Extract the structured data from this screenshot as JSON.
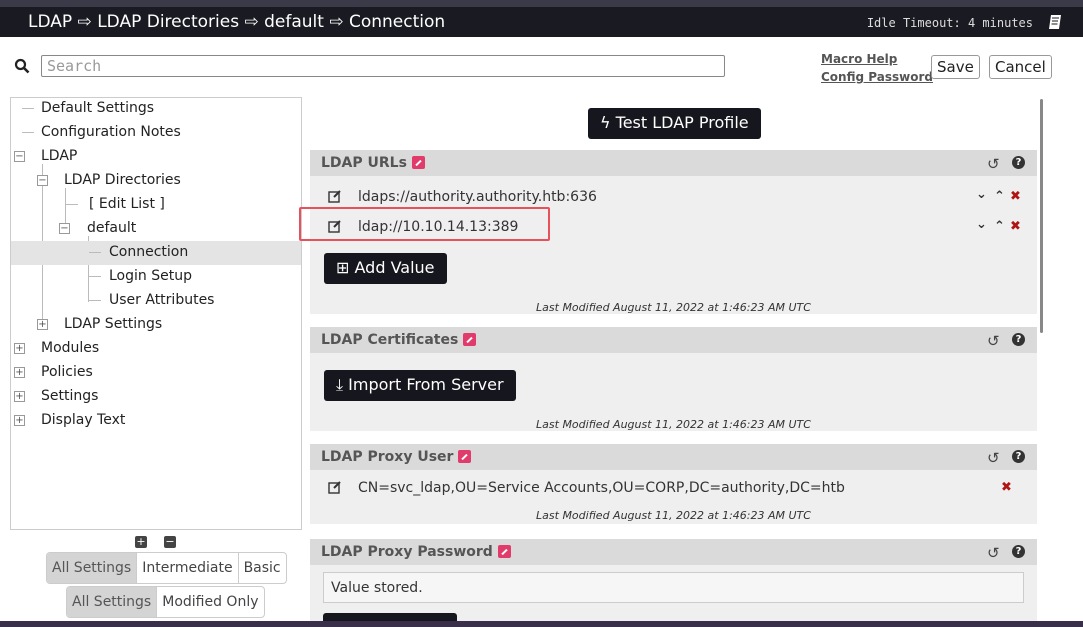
{
  "header": {
    "title": "LDAP ⇨ LDAP Directories ⇨ default ⇨ Connection",
    "idle_timeout": "Idle Timeout: 4 minutes"
  },
  "search": {
    "placeholder": "Search",
    "value": ""
  },
  "links": {
    "macro_help": "Macro Help",
    "config_password": "Config Password"
  },
  "buttons": {
    "save": "Save",
    "cancel": "Cancel"
  },
  "tree": {
    "items": [
      {
        "label": "Default Settings"
      },
      {
        "label": "Configuration Notes"
      },
      {
        "label": "LDAP"
      },
      {
        "label": "LDAP Directories"
      },
      {
        "label": "[ Edit List ]"
      },
      {
        "label": "default"
      },
      {
        "label": "Connection"
      },
      {
        "label": "Login Setup"
      },
      {
        "label": "User Attributes"
      },
      {
        "label": "LDAP Settings"
      },
      {
        "label": "Modules"
      },
      {
        "label": "Policies"
      },
      {
        "label": "Settings"
      },
      {
        "label": "Display Text"
      }
    ]
  },
  "level_filter": {
    "options": [
      "All Settings",
      "Intermediate",
      "Basic"
    ],
    "selected": "All Settings"
  },
  "modified_filter": {
    "options": [
      "All Settings",
      "Modified Only"
    ],
    "selected": "All Settings"
  },
  "main": {
    "test_button": "Test LDAP Profile",
    "panels": [
      {
        "title": "LDAP URLs",
        "values": [
          "ldaps://authority.authority.htb:636",
          "ldap://10.10.14.13:389"
        ],
        "add_button": "Add Value",
        "modified": "Last Modified August 11, 2022 at 1:46:23 AM UTC"
      },
      {
        "title": "LDAP Certificates",
        "import_button": "Import From Server",
        "modified": "Last Modified August 11, 2022 at 1:46:23 AM UTC"
      },
      {
        "title": "LDAP Proxy User",
        "value": "CN=svc_ldap,OU=Service Accounts,OU=CORP,DC=authority,DC=htb",
        "modified": "Last Modified August 11, 2022 at 1:46:23 AM UTC"
      },
      {
        "title": "LDAP Proxy Password",
        "value": "Value stored."
      }
    ]
  },
  "colors": {
    "header_bg": "#1a1a22",
    "accent_delete": "#b01414",
    "edit_badge": "#e03b6a",
    "highlight": "#e8505b"
  }
}
